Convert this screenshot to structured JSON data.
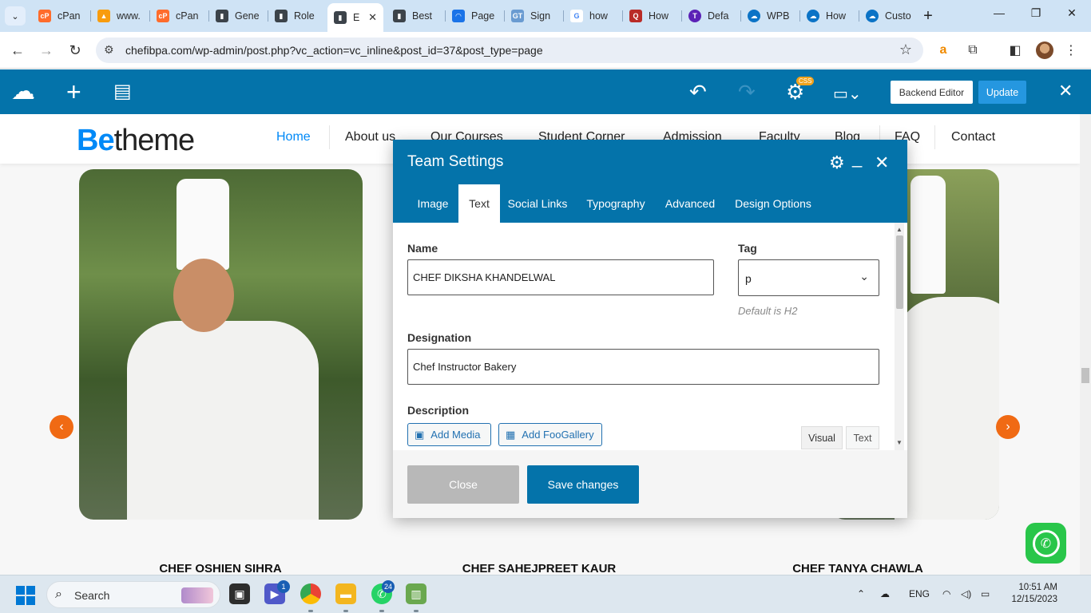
{
  "browser": {
    "tabs": [
      {
        "label": "cPan",
        "icon": "cpanel-icon",
        "color": "#ff6c2c"
      },
      {
        "label": "www.",
        "icon": "phpmyadmin-icon",
        "color": "#f89c0e"
      },
      {
        "label": "cPan",
        "icon": "cpanel-icon",
        "color": "#ff6c2c"
      },
      {
        "label": "Gene",
        "icon": "wp-settings-icon",
        "color": "#3c434a"
      },
      {
        "label": "Role",
        "icon": "wp-settings-icon",
        "color": "#3c434a"
      },
      {
        "label": "E",
        "icon": "wp-settings-icon",
        "color": "#3c434a"
      },
      {
        "label": "Best",
        "icon": "wp-settings-icon",
        "color": "#3c434a"
      },
      {
        "label": "Page",
        "icon": "pagespeed-icon",
        "color": "#1a73e8"
      },
      {
        "label": "Sign",
        "icon": "gtmetrix-icon",
        "color": "#6a9bd1"
      },
      {
        "label": "how",
        "icon": "google-icon",
        "color": "#4285f4"
      },
      {
        "label": "How",
        "icon": "quora-icon",
        "color": "#b92b27"
      },
      {
        "label": "Defa",
        "icon": "t-icon",
        "color": "#5b21b6"
      },
      {
        "label": "WPB",
        "icon": "cloud-icon",
        "color": "#0b73c6"
      },
      {
        "label": "How",
        "icon": "cloud-icon",
        "color": "#0b73c6"
      },
      {
        "label": "Custo",
        "icon": "cloud-icon",
        "color": "#0b73c6"
      }
    ],
    "active_tab_index": 5,
    "url": "chefibpa.com/wp-admin/post.php?vc_action=vc_inline&post_id=37&post_type=page"
  },
  "vc_toolbar": {
    "css_badge": "CSS",
    "backend_editor_label": "Backend Editor",
    "update_label": "Update"
  },
  "site": {
    "logo_be": "Be",
    "logo_theme": "theme",
    "menu": [
      "Home",
      "About us",
      "Our Courses",
      "Student Corner",
      "Admission",
      "Faculty",
      "Blog",
      "FAQ",
      "Contact"
    ],
    "active_menu": "Home",
    "chefs": [
      "CHEF OSHIEN SIHRA",
      "CHEF SAHEJPREET KAUR",
      "CHEF TANYA CHAWLA"
    ]
  },
  "modal": {
    "title": "Team Settings",
    "tabs": [
      "Image",
      "Text",
      "Social Links",
      "Typography",
      "Advanced",
      "Design Options"
    ],
    "active_tab": "Text",
    "name_label": "Name",
    "name_value": "CHEF DIKSHA KHANDELWAL",
    "tag_label": "Tag",
    "tag_value": "p",
    "tag_hint": "Default is H2",
    "designation_label": "Designation",
    "designation_value": "Chef Instructor Bakery",
    "description_label": "Description",
    "add_media_label": "Add Media",
    "add_foogallery_label": "Add FooGallery",
    "editor_visual": "Visual",
    "editor_text": "Text",
    "close_label": "Close",
    "save_label": "Save changes"
  },
  "taskbar": {
    "search_label": "Search",
    "meet_badge": "1",
    "whatsapp_badge": "24",
    "language": "ENG",
    "time": "10:51 AM",
    "date": "12/15/2023"
  }
}
